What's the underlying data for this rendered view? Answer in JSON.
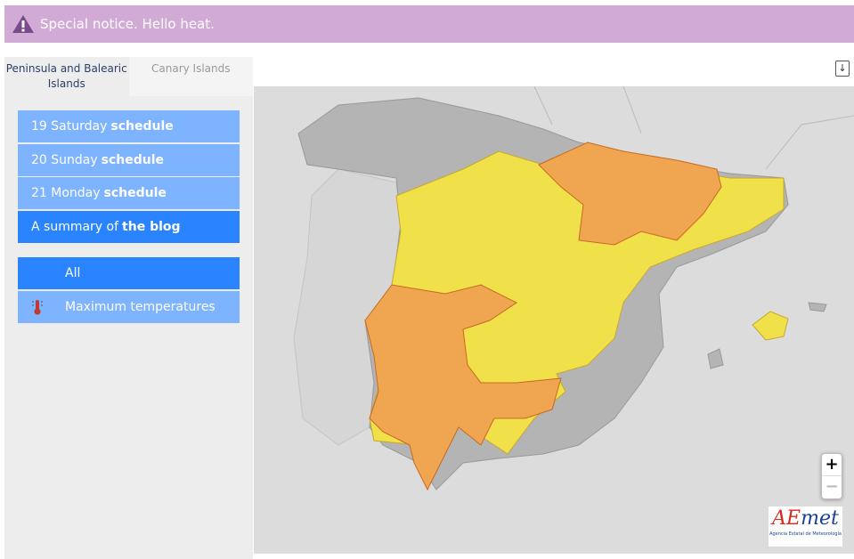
{
  "notice": {
    "text": "Special notice. Hello heat.",
    "icon": "warning-icon",
    "color": "#d1aad5"
  },
  "tabs": [
    {
      "label": "Peninsula and Balearic Islands",
      "active": true
    },
    {
      "label": "Canary Islands",
      "active": false
    }
  ],
  "days": [
    {
      "pre": "19 Saturday",
      "bold": "schedule"
    },
    {
      "pre": "20 Sunday",
      "bold": "schedule"
    },
    {
      "pre": "21 Monday",
      "bold": "schedule"
    },
    {
      "pre": "A summary of",
      "bold": "the blog",
      "selected": true
    }
  ],
  "filters": [
    {
      "label": "All",
      "selected": true
    },
    {
      "label": "Maximum temperatures",
      "icon": "thermometer-icon"
    }
  ],
  "map": {
    "legend_colors": {
      "yellow": "#f0e04a",
      "orange": "#f0a550",
      "none": "#b4b4b4"
    }
  },
  "zoom": {
    "in": "+",
    "out": "−"
  },
  "download_icon": "download-icon",
  "logo": {
    "brand_a": "AE",
    "brand_b": "met",
    "sub": "Agencia Estatal de Meteorología"
  }
}
